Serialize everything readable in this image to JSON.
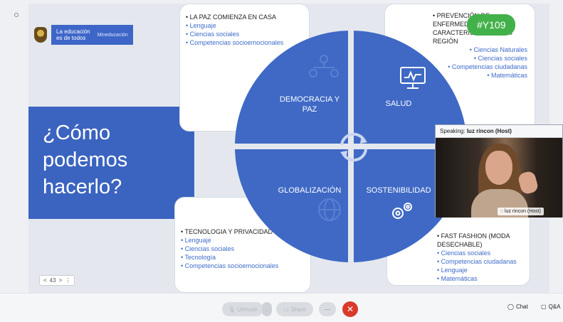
{
  "slide": {
    "brand": {
      "line1": "La educación",
      "line2": "es de todos",
      "ministry": "Mineducación"
    },
    "question": "¿Cómo\npodemos\nhacerlo?",
    "cards": {
      "top_left": {
        "title": "LA PAZ COMIENZA EN CASA",
        "items": [
          "Lenguaje",
          "Ciencias sociales",
          "Competencias socioemocionales"
        ]
      },
      "top_right": {
        "title": "PREVENCIÓN DE ENFERMEDADES CARACTERÍSTICAS DE MI REGIÓN",
        "title_visible": "PREVEN... ENFE... CARAC... MI REGIÓN",
        "items": [
          "Ciencias Naturales",
          "Ciencias sociales",
          "Competencias ciudadanas",
          "Matemáticas"
        ]
      },
      "bottom_left": {
        "title": "TECNOLOGIA Y PRIVACIDAD",
        "items": [
          "Lenguaje",
          "Ciencias sociales",
          "Tecnología",
          "Competencias socioemocionales"
        ]
      },
      "bottom_right": {
        "title": "FAST FASHION  (MODA DESECHABLE)",
        "items": [
          "Ciencias sociales",
          "Competencias ciudadanas",
          "Lenguaje",
          "Matemáticas"
        ]
      }
    },
    "quadrants": {
      "tl": "DEMOCRACIA Y PAZ",
      "tr": "SALUD",
      "bl": "GLOBALIZACIÓN",
      "br": "SOSTENIBILIDAD"
    },
    "pager": {
      "prev": "<",
      "page": "43",
      "next": ">",
      "more": "⋮"
    }
  },
  "tag": "#Y109",
  "video": {
    "speaking_label": "Speaking:",
    "speaking_name": "luz rincon (Host)",
    "name_tag": "luz rincon  (Host)"
  },
  "toolbar": {
    "unmute": "Unmute",
    "share": "Share",
    "more": "···",
    "end": "✕",
    "chat": "Chat",
    "qa": "Q&A"
  },
  "colors": {
    "blue": "#3b64c0",
    "circle": "#3f69c5",
    "green": "#43b14a",
    "end_red": "#d93a2b"
  }
}
